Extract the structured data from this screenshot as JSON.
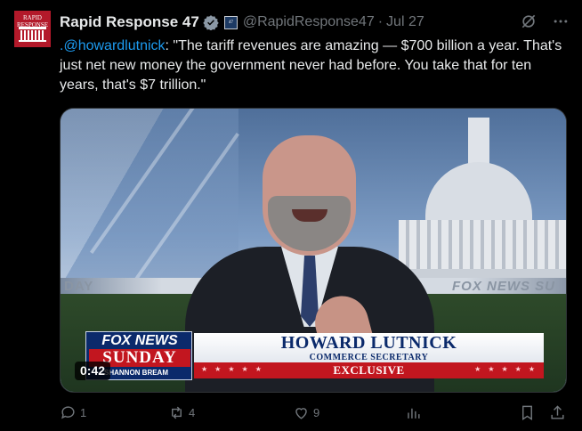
{
  "avatar": {
    "line1": "RAPID",
    "line2": "RESPONSE"
  },
  "tweet": {
    "display_name": "Rapid Response 47",
    "handle": "@RapidResponse47",
    "separator": "·",
    "date": "Jul 27",
    "mention": ".@howardlutnick",
    "text": ": \"The tariff revenues are amazing — $700 billion a year. That's just net new money the government never had before. You take that for ten years, that's $7 trillion.\""
  },
  "video": {
    "duration": "0:42",
    "lower_third": {
      "logo_top": "FOX NEWS",
      "logo_show": "SUNDAY",
      "host": "SHANNON BREAM",
      "name": "HOWARD LUTNICK",
      "title": "COMMERCE SECRETARY",
      "tag": "EXCLUSIVE"
    },
    "wall_left": "DAY",
    "wall_right": "FOX NEWS SU"
  },
  "actions": {
    "replies": "1",
    "reposts": "4",
    "likes": "9"
  },
  "icons": [
    "verified-badge-icon",
    "grok-icon",
    "more-icon",
    "reply-icon",
    "repost-icon",
    "like-icon",
    "views-icon",
    "bookmark-icon",
    "share-icon"
  ],
  "colors": {
    "background": "#000000",
    "text": "#e7e9ea",
    "muted": "#71767b",
    "link": "#1d9bf0",
    "fox_red": "#c2161f",
    "fox_blue": "#0b2a6b"
  }
}
